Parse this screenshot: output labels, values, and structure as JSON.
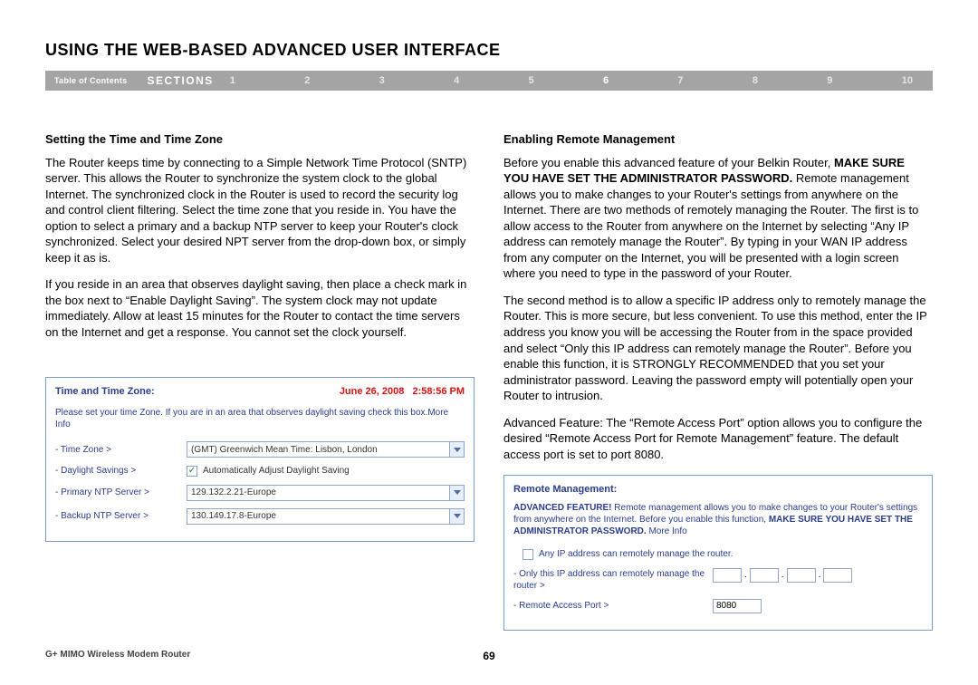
{
  "page_title": "USING THE WEB-BASED ADVANCED USER INTERFACE",
  "nav": {
    "toc": "Table of Contents",
    "sections": "SECTIONS",
    "nums": [
      "1",
      "2",
      "3",
      "4",
      "5",
      "6",
      "7",
      "8",
      "9",
      "10"
    ],
    "active": "6"
  },
  "left": {
    "heading": "Setting the Time and Time Zone",
    "p1": "The Router keeps time by connecting to a Simple Network Time Protocol (SNTP) server. This allows the Router to synchronize the system clock to the global Internet. The synchronized clock in the Router is used to record the security log and control client filtering. Select the time zone that you reside in. You have the option to select a primary and a backup NTP server to keep your Router's clock synchronized. Select your desired NPT server from the drop-down box, or simply keep it as is.",
    "p2": "If you reside in an area that observes daylight saving, then place a check mark in the box next to “Enable Daylight Saving”. The system clock may not update immediately. Allow at least 15 minutes for the Router to contact the time servers on the Internet and get a response. You cannot set the clock yourself.",
    "panel": {
      "title": "Time and Time Zone:",
      "datetime": "June 26, 2008   2:58:56 PM",
      "desc": "Please set your time Zone. If you are in an area that observes daylight saving check this box.More Info",
      "tz_label": "- Time Zone >",
      "tz_value": "(GMT) Greenwich Mean Time: Lisbon, London",
      "ds_label": "- Daylight Savings >",
      "ds_text": "Automatically Adjust Daylight Saving",
      "pntp_label": "- Primary NTP Server >",
      "pntp_value": "129.132.2.21-Europe",
      "bntp_label": "- Backup NTP Server >",
      "bntp_value": "130.149.17.8-Europe"
    }
  },
  "right": {
    "heading": "Enabling Remote Management",
    "p1a": "Before you enable this advanced feature of your Belkin Router, ",
    "p1b": "MAKE SURE YOU HAVE SET THE ADMINISTRATOR PASSWORD.",
    "p1c": " Remote management allows you to make changes to your Router's settings from anywhere on the Internet. There are two methods of remotely managing the Router. The first is to allow access to the Router from anywhere on the Internet by selecting “Any IP address can remotely manage the Router”. By typing in your WAN IP address from any computer on the Internet, you will be presented with a login screen where you need to type in the password of your Router.",
    "p2": "The second method is to allow a specific IP address only to remotely manage the Router. This is more secure, but less convenient. To use this method, enter the IP address you know you will be accessing the Router from in the space provided and select “Only this IP address can remotely manage the Router”. Before you enable this function, it is STRONGLY RECOMMENDED that you set your administrator password. Leaving the password empty will potentially open your Router to intrusion.",
    "p3": "Advanced Feature: The “Remote Access Port” option allows you to configure the desired “Remote Access Port for Remote Management” feature. The default access port is set to port 8080.",
    "panel": {
      "title": "Remote Management:",
      "desc1": "ADVANCED FEATURE!",
      "desc2": " Remote management allows you to make changes to your Router's settings from anywhere on the Internet. Before you enable this function, ",
      "desc3": "MAKE SURE YOU HAVE SET THE ADMINISTRATOR PASSWORD.",
      "desc4": " More Info",
      "anyip_text": "Any IP address can remotely manage the router.",
      "onlyip_label": "- Only this IP address can remotely manage the router >",
      "port_label": "- Remote Access Port >",
      "port_value": "8080"
    }
  },
  "footer": {
    "model": "G+ MIMO Wireless Modem Router",
    "pagenum": "69"
  }
}
